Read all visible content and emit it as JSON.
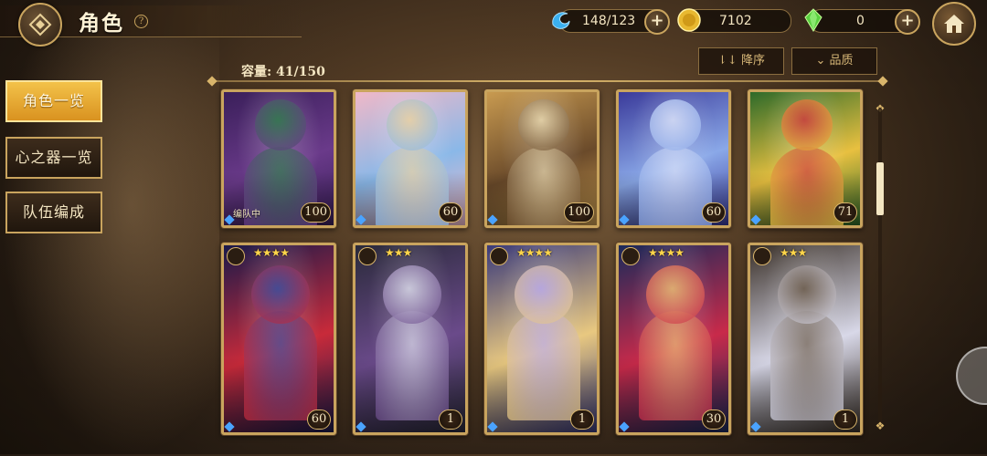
{
  "header": {
    "title": "角色",
    "help_label": "?"
  },
  "resources": {
    "stamina": {
      "icon": "water-spirit-icon",
      "value": "148/123"
    },
    "gold": {
      "icon": "gold-coin-icon",
      "value": "7102"
    },
    "gem": {
      "icon": "green-crystal-icon",
      "value": "0"
    }
  },
  "side_menu": [
    {
      "label": "角色一览",
      "active": true
    },
    {
      "label": "心之器一览",
      "active": false
    },
    {
      "label": "队伍编成",
      "active": false
    }
  ],
  "capacity": "容量: 41/150",
  "sort": {
    "order_label": "降序",
    "quality_label": "品质"
  },
  "cards": {
    "row1": [
      {
        "level": "100",
        "tag": "编队中",
        "colors": [
          "#3a1f5a",
          "#6a3a8a",
          "#2e7a4a"
        ]
      },
      {
        "level": "60",
        "tag": "",
        "colors": [
          "#f0b8c8",
          "#8ab8e8",
          "#e8d0a0"
        ]
      },
      {
        "level": "100",
        "tag": "",
        "colors": [
          "#c89a50",
          "#6a4a2a",
          "#e8d8b0"
        ]
      },
      {
        "level": "60",
        "tag": "",
        "colors": [
          "#3a3a9a",
          "#8aa8e8",
          "#d8e0f8"
        ]
      },
      {
        "level": "71",
        "tag": "",
        "colors": [
          "#2e6a2a",
          "#e8c040",
          "#c83a3a"
        ]
      }
    ],
    "row2": [
      {
        "level": "60",
        "stars": "★★★★",
        "colors": [
          "#1a1a4a",
          "#c82a3a",
          "#3a4a9a"
        ]
      },
      {
        "level": "1",
        "stars": "★★★",
        "colors": [
          "#2a2a3a",
          "#6a4a8a",
          "#d8d8e8"
        ]
      },
      {
        "level": "1",
        "stars": "★★★★",
        "colors": [
          "#3a3a7a",
          "#e8c880",
          "#b8a8e8"
        ]
      },
      {
        "level": "30",
        "stars": "★★★★",
        "colors": [
          "#1a2a5a",
          "#c82a4a",
          "#e8b870"
        ]
      },
      {
        "level": "1",
        "stars": "★★★",
        "colors": [
          "#3a3028",
          "#d8d8e8",
          "#6a5a4a"
        ]
      }
    ]
  }
}
